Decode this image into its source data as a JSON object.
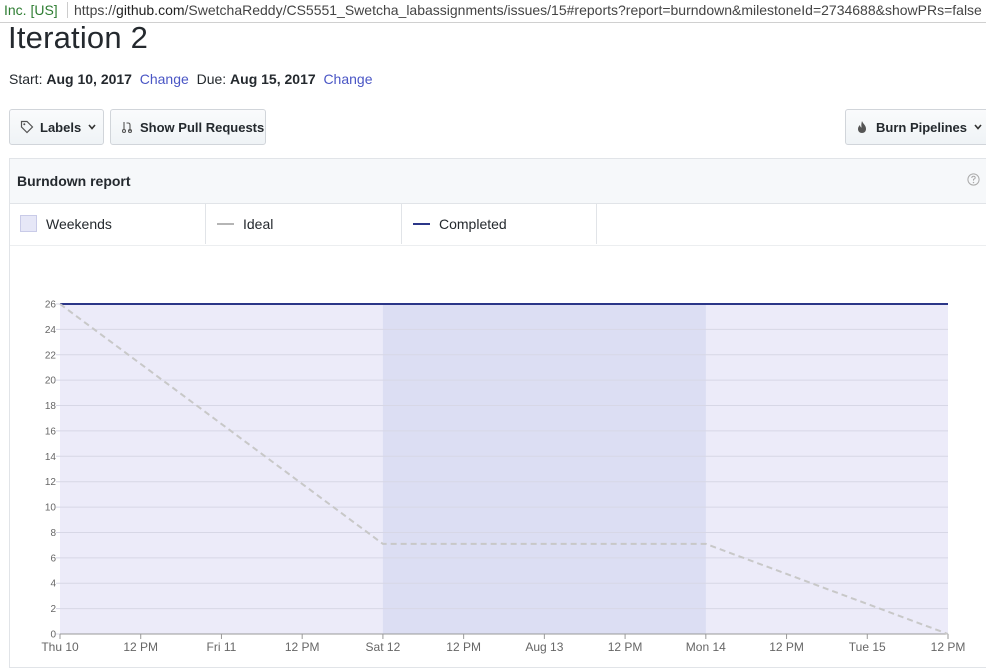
{
  "browser": {
    "site_identity": "Inc. [US]",
    "url_prefix": "https://",
    "url_host": "github.com",
    "url_rest": "/SwetchaReddy/CS5551_Swetcha_labassignments/issues/15#reports?report=burndown&milestoneId=2734688&showPRs=false"
  },
  "milestone": {
    "title": "Iteration 2",
    "start_label": "Start:",
    "start_date": "Aug 10, 2017",
    "start_change": "Change",
    "due_label": "Due:",
    "due_date": "Aug 15, 2017",
    "due_change": "Change"
  },
  "toolbar": {
    "labels_button": "Labels",
    "pull_requests_button": "Show Pull Requests",
    "burn_pipelines_button": "Burn Pipelines"
  },
  "report": {
    "title": "Burndown report",
    "legend": [
      "Weekends",
      "Ideal",
      "Completed"
    ]
  },
  "colors": {
    "completed": "#2b3688",
    "ideal": "#c8c8c8",
    "plot_background": "#ecebf9",
    "weekend_band": "#dcdef3",
    "link": "#4a56c5"
  },
  "icons": {
    "labels": "tag-icon",
    "pull_requests": "git-pull-request-icon",
    "burn_pipelines": "flame-icon",
    "help": "question-icon"
  },
  "chart_data": {
    "type": "line",
    "title": "",
    "xlabel": "",
    "ylabel": "",
    "ylim": [
      0,
      26
    ],
    "yticks": [
      0,
      2,
      4,
      6,
      8,
      10,
      12,
      14,
      16,
      18,
      20,
      22,
      24,
      26
    ],
    "x_tick_labels": [
      "Thu 10",
      "12 PM",
      "Fri 11",
      "12 PM",
      "Sat 12",
      "12 PM",
      "Aug 13",
      "12 PM",
      "Mon 14",
      "12 PM",
      "Tue 15",
      "12 PM"
    ],
    "x_range_hours": [
      0,
      132
    ],
    "weekend_band_hours": [
      48,
      96
    ],
    "grid": true,
    "legend_position": "top",
    "series": [
      {
        "name": "Completed",
        "style": "solid",
        "points": [
          {
            "x": "Thu 10",
            "y": 26
          },
          {
            "x": "Tue 15 12 PM",
            "y": 26
          }
        ]
      },
      {
        "name": "Ideal",
        "style": "dashed",
        "points": [
          {
            "x": "Thu 10",
            "y": 26
          },
          {
            "x": "Sat 12",
            "y": 7.1
          },
          {
            "x": "Mon 14",
            "y": 7.1
          },
          {
            "x": "Tue 15 12 PM",
            "y": 0
          }
        ]
      }
    ]
  }
}
